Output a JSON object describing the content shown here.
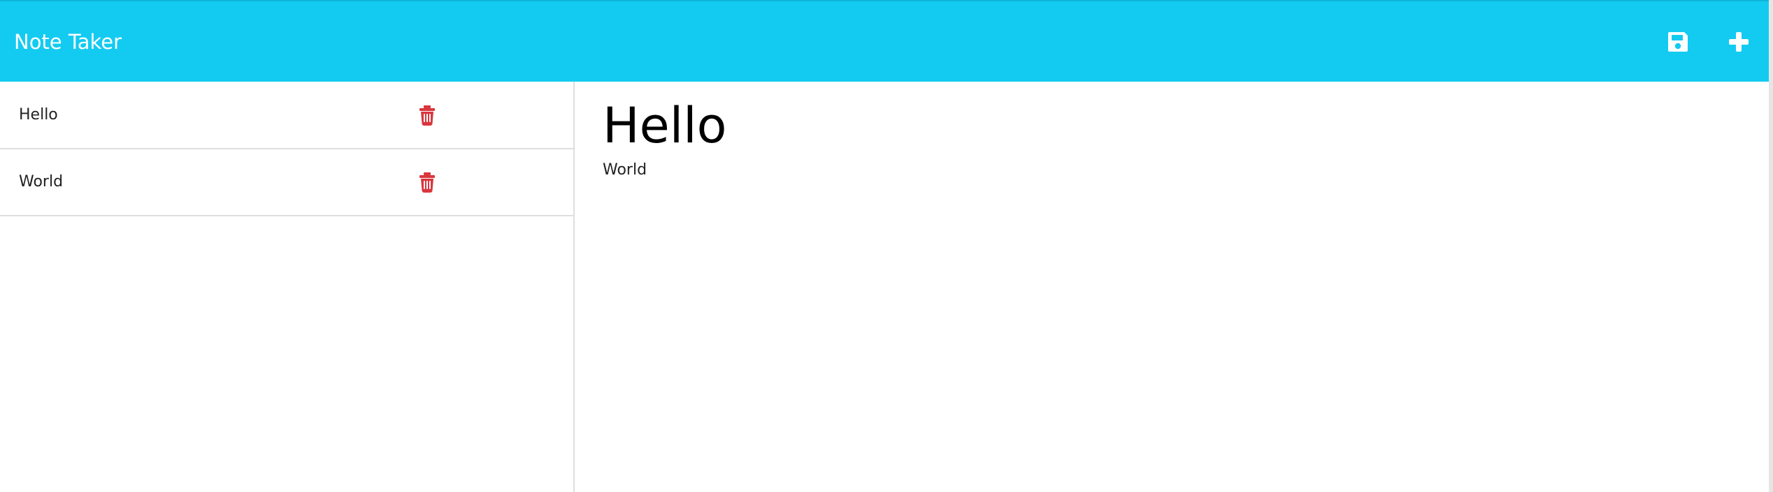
{
  "app": {
    "title": "Note Taker"
  },
  "toolbar": {
    "save_icon": "save-icon",
    "new_icon": "plus-icon"
  },
  "sidebar": {
    "notes": [
      {
        "title": "Hello",
        "delete_icon": "trash-icon"
      },
      {
        "title": "World",
        "delete_icon": "trash-icon"
      }
    ]
  },
  "editor": {
    "title": "Hello",
    "body": "World"
  },
  "colors": {
    "navbar": "#13cbf1",
    "navbar_text": "#ffffff",
    "delete": "#d9363e",
    "divider": "#dedede"
  }
}
